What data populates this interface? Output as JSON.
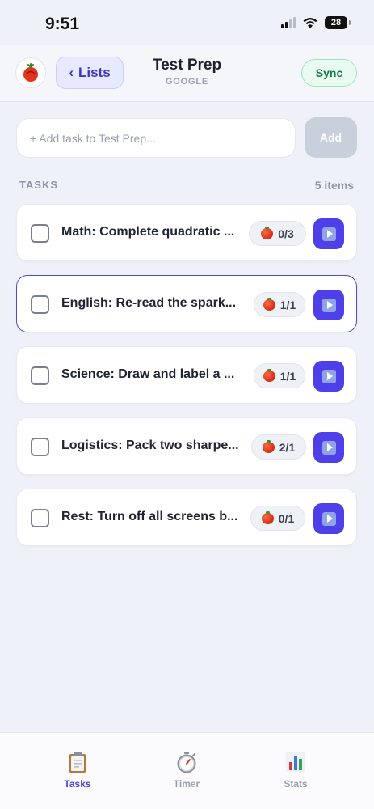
{
  "status_bar": {
    "time": "9:51",
    "battery": "28"
  },
  "header": {
    "back_label": "Lists",
    "title": "Test Prep",
    "subtitle": "GOOGLE",
    "sync_label": "Sync"
  },
  "add_task": {
    "placeholder": "+ Add task to Test Prep...",
    "button_label": "Add"
  },
  "tasks_section": {
    "title": "TASKS",
    "count": "5 items"
  },
  "tasks": [
    {
      "text": "Math: Complete quadratic ...",
      "pomodoros": "0/3",
      "selected": false
    },
    {
      "text": "English: Re-read the spark...",
      "pomodoros": "1/1",
      "selected": true
    },
    {
      "text": "Science: Draw and label a ...",
      "pomodoros": "1/1",
      "selected": false
    },
    {
      "text": "Logistics: Pack two sharpe...",
      "pomodoros": "2/1",
      "selected": false
    },
    {
      "text": "Rest: Turn off all screens b...",
      "pomodoros": "0/1",
      "selected": false
    }
  ],
  "tab_bar": {
    "tabs": [
      {
        "label": "Tasks",
        "icon": "clipboard-icon",
        "active": true
      },
      {
        "label": "Timer",
        "icon": "stopwatch-icon",
        "active": false
      },
      {
        "label": "Stats",
        "icon": "bar-chart-icon",
        "active": false
      }
    ]
  },
  "colors": {
    "accent": "#4f3fe8",
    "sync_green": "#137a43",
    "background": "#eef1f7"
  }
}
